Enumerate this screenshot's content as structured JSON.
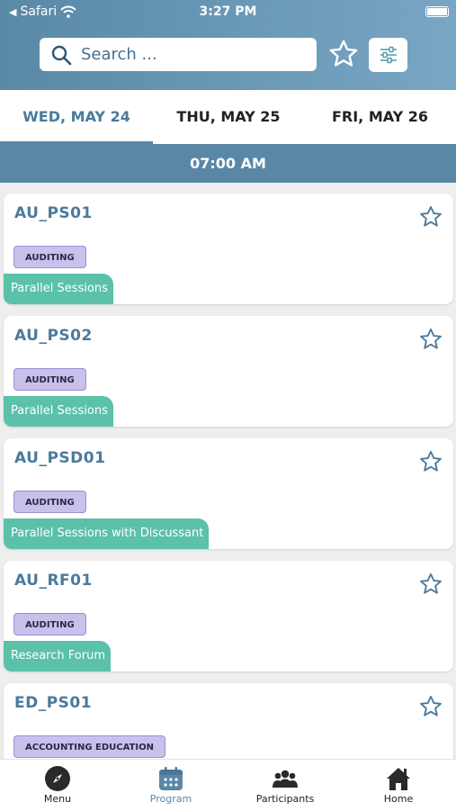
{
  "status_bar": {
    "back_app": "Safari",
    "time": "3:27 PM"
  },
  "search": {
    "placeholder": "Search ..."
  },
  "day_tabs": [
    {
      "label": "WED, MAY 24",
      "active": true
    },
    {
      "label": "THU, MAY 25",
      "active": false
    },
    {
      "label": "FRI, MAY 26",
      "active": false
    }
  ],
  "time_slot": "07:00 AM",
  "sessions": [
    {
      "code": "AU_PS01",
      "tag": "AUDITING",
      "type": "Parallel Sessions"
    },
    {
      "code": "AU_PS02",
      "tag": "AUDITING",
      "type": "Parallel Sessions"
    },
    {
      "code": "AU_PSD01",
      "tag": "AUDITING",
      "type": "Parallel Sessions with Discussant"
    },
    {
      "code": "AU_RF01",
      "tag": "AUDITING",
      "type": "Research Forum"
    },
    {
      "code": "ED_PS01",
      "tag": "ACCOUNTING EDUCATION",
      "type": ""
    }
  ],
  "bottom_nav": [
    {
      "label": "Menu",
      "icon": "compass-icon",
      "active": false
    },
    {
      "label": "Program",
      "icon": "calendar-icon",
      "active": true
    },
    {
      "label": "Participants",
      "icon": "people-icon",
      "active": false
    },
    {
      "label": "Home",
      "icon": "home-icon",
      "active": false
    }
  ],
  "colors": {
    "header_start": "#5a89a8",
    "header_end": "#78a6c4",
    "accent": "#5b87a6",
    "tag_bg": "#c9c0ec",
    "type_bg": "#5bc1a9"
  }
}
